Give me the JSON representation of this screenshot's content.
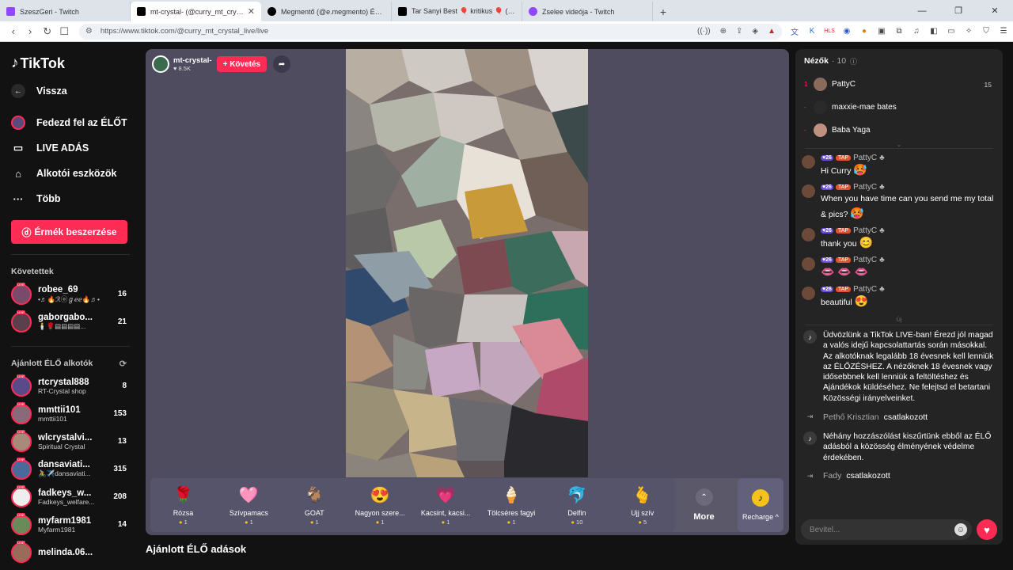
{
  "browser": {
    "tabs": [
      {
        "title": "SzeszGeri - Twitch",
        "color": "#9146ff"
      },
      {
        "title": "mt-crystal- (@curry_mt_crystal_live)",
        "color": "#000000"
      },
      {
        "title": "Megmentő (@e.megmento) ÉLŐ adás",
        "color": "#000000"
      },
      {
        "title": "Tar Sanyi Best 🎈 kritikus 🎈 (@szop",
        "color": "#000000"
      },
      {
        "title": "Zselee videója - Twitch",
        "color": "#9146ff"
      }
    ],
    "url": "https://www.tiktok.com/@curry_mt_crystal_live/live"
  },
  "sidebar": {
    "logo": "TikTok",
    "nav": [
      {
        "label": "Vissza",
        "icon": "back-arrow-icon"
      },
      {
        "label": "Fedezd fel az ÉLŐT",
        "icon": "explore-live-icon"
      },
      {
        "label": "LIVE ADÁS",
        "icon": "video-camera-icon"
      },
      {
        "label": "Alkotói eszközök",
        "icon": "creator-tools-icon"
      },
      {
        "label": "Több",
        "icon": "more-dots-icon"
      }
    ],
    "coins_button": "Érmék beszerzése",
    "following_header": "Követettek",
    "following": [
      {
        "name": "robee_69",
        "sub": "•♬🔥ℛⓞℊℯℯ🔥♬•",
        "count": "16",
        "color": "#7a4a6a"
      },
      {
        "name": "gaborgabo...",
        "sub": "🕯️🌹▤▤▤▤...",
        "count": "21",
        "color": "#5b3f4b"
      }
    ],
    "recommended_header": "Ajánlott ÉLŐ alkotók",
    "recommended": [
      {
        "name": "rtcrystal888",
        "sub": "RT-Crystal shop",
        "count": "8",
        "color": "#5a4a8a"
      },
      {
        "name": "mmttii101",
        "sub": "mmttii101",
        "count": "153",
        "color": "#8a6a7a"
      },
      {
        "name": "wlcrystalvi...",
        "sub": "Spiritual Crystal",
        "count": "13",
        "color": "#a88a7a"
      },
      {
        "name": "dansaviati...",
        "sub": "🚴✈️dansaviati...",
        "count": "315",
        "color": "#4a6a9a"
      },
      {
        "name": "fadkeys_w...",
        "sub": "Fadkeys_welfare...",
        "count": "208",
        "color": "#eeeeee"
      },
      {
        "name": "myfarm1981",
        "sub": "Myfarm1981",
        "count": "14",
        "color": "#6a8a5a"
      },
      {
        "name": "melinda.06...",
        "sub": "",
        "count": "",
        "color": "#9a6a5a"
      }
    ]
  },
  "player": {
    "host_name": "mt-crystal-",
    "host_likes": "♥ 8.5K",
    "follow_button": "+ Követés",
    "gifts": [
      {
        "name": "Rózsa",
        "price": "1",
        "icon": "🌹"
      },
      {
        "name": "Szívpamacs",
        "price": "1",
        "icon": "🩷"
      },
      {
        "name": "GOAT",
        "price": "1",
        "icon": "🐐"
      },
      {
        "name": "Nagyon szere...",
        "price": "1",
        "icon": "😍"
      },
      {
        "name": "Kacsint, kacsi...",
        "price": "1",
        "icon": "💗"
      },
      {
        "name": "Tölcséres fagyi",
        "price": "1",
        "icon": "🍦"
      },
      {
        "name": "Delfin",
        "price": "10",
        "icon": "🐬"
      },
      {
        "name": "Ujj szív",
        "price": "5",
        "icon": "🫰"
      }
    ],
    "more_label": "More",
    "recharge_label": "Recharge ^"
  },
  "recommended_lives": "Ajánlott ÉLŐ adások",
  "viewers": {
    "title": "Nézők",
    "count": "· 10",
    "list": [
      {
        "rank": "1",
        "name": "PattyC",
        "score": "15",
        "color": "#8a6a5a"
      },
      {
        "rank": "-",
        "name": "maxxie-mae bates",
        "score": "",
        "color": "#2a2a2a"
      },
      {
        "rank": "-",
        "name": "Baba Yaga",
        "score": "",
        "color": "#c09080"
      }
    ]
  },
  "chat": {
    "messages": [
      {
        "level": "26",
        "fan": "TAP",
        "user": "PattyC",
        "text": "Hi Curry",
        "emoji": "🥵"
      },
      {
        "level": "26",
        "fan": "TAP",
        "user": "PattyC",
        "text": "When you have time can you send me my total & pics?",
        "emoji": "🥵"
      },
      {
        "level": "26",
        "fan": "TAP",
        "user": "PattyC",
        "text": "thank you",
        "emoji": "😊"
      },
      {
        "level": "26",
        "fan": "TAP",
        "user": "PattyC",
        "text": "",
        "emoji": "👄 👄 👄"
      },
      {
        "level": "26",
        "fan": "TAP",
        "user": "PattyC",
        "text": "beautiful",
        "emoji": "😍"
      }
    ],
    "new_divider": "Új",
    "welcome": "Üdvözlünk a TikTok LIVE-ban! Érezd jól magad a valós idejű kapcsolattartás során másokkal. Az alkotóknak legalább 18 évesnek kell lenniük az ÉLŐZÉSHEZ. A nézőknek 18 évesnek vagy idősebbnek kell lenniük a feltöltéshez és Ajándékok küldéséhez. Ne felejtsd el betartani Közösségi irányelveinket.",
    "join1_name": "Pethő Krisztian",
    "join1_text": "csatlakozott",
    "filter_notice": "Néhány hozzászólást kiszűrtünk ebből az ÉLŐ adásból a közösség élményének védelme érdekében.",
    "join2_name": "Fady",
    "join2_text": "csatlakozott",
    "input_placeholder": "Bevitel..."
  }
}
